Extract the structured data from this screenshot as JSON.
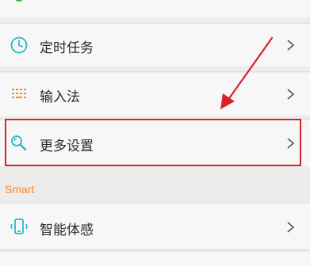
{
  "colors": {
    "accent_teal": "#29b6c9",
    "input_orange": "#f08c2c",
    "section_orange": "#ef8b3a",
    "highlight_red": "#d8232a",
    "top_icon_green": "#4caf50"
  },
  "top_partial": {
    "icon": "green-icon",
    "label": "",
    "clipped": true
  },
  "settings": {
    "timer": {
      "label": "定时任务",
      "icon": "clock-icon"
    },
    "input_method": {
      "label": "输入法",
      "icon": "keyboard-icon"
    },
    "more_settings": {
      "label": "更多设置",
      "icon": "wrench-icon",
      "highlighted": true
    }
  },
  "smart_section": {
    "title": "Smart",
    "items": [
      {
        "label": "智能体感",
        "icon": "phone-gesture-icon"
      }
    ]
  },
  "annotation": {
    "arrow_color": "#d8232a",
    "points_to": "more_settings"
  }
}
